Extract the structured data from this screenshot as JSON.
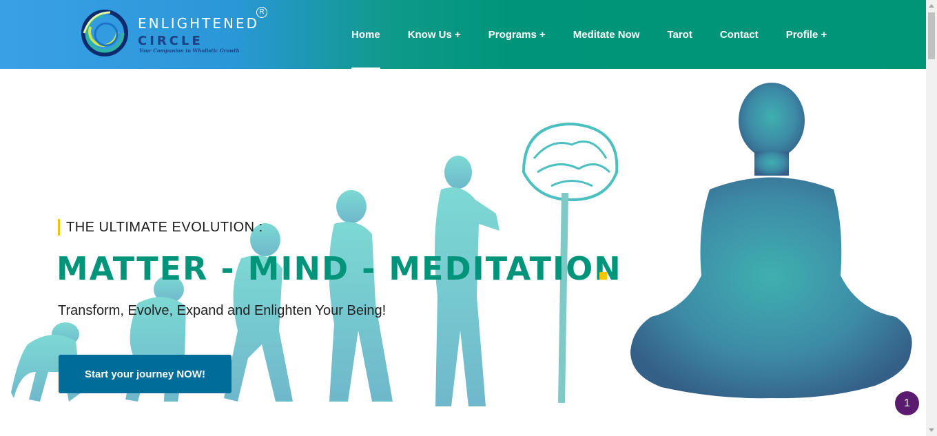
{
  "header": {
    "logo": {
      "title": "ENLIGHTENED",
      "subtitle": "CIRCLE",
      "tagline": "Your Companion in Wholistic Growth",
      "registered": "R"
    },
    "nav": [
      {
        "label": "Home",
        "active": true
      },
      {
        "label": "Know Us +"
      },
      {
        "label": "Programs +"
      },
      {
        "label": "Meditate Now"
      },
      {
        "label": "Tarot"
      },
      {
        "label": "Contact"
      },
      {
        "label": "Profile +"
      }
    ]
  },
  "hero": {
    "eyebrow": "THE ULTIMATE EVOLUTION :",
    "headline": "MATTER - MIND - MEDITATION",
    "subline": "Transform, Evolve, Expand and Enlighten Your Being!",
    "cta_label": "Start your journey NOW!"
  },
  "notification": {
    "count": "1"
  },
  "colors": {
    "brand_green": "#00957a",
    "brand_blue": "#3aa0e6",
    "cta_blue": "#006d99",
    "accent_yellow": "#f5c600",
    "badge_purple": "#5a1a6e"
  },
  "icons": [
    "enlightened-circle-logo",
    "evolution-figures-illustration",
    "brain-spine-illustration",
    "meditating-figure-illustration"
  ]
}
